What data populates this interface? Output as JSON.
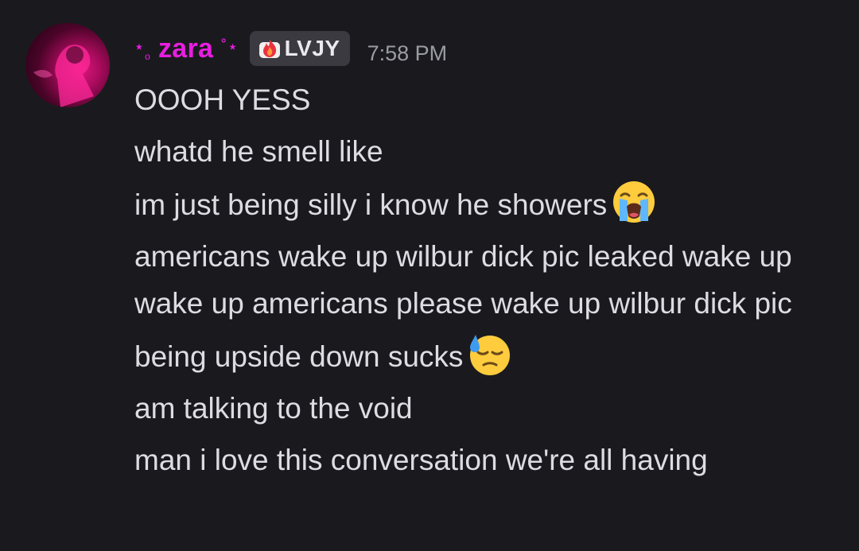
{
  "message": {
    "author": {
      "prefix_deco": "⋆",
      "prefix_circle": "ₒ",
      "name": "zara",
      "suffix_circle": "˚",
      "suffix_deco": "⋆",
      "color": "#e81ee0"
    },
    "tag": {
      "label": "LVJY",
      "icon": "fire-badge-icon"
    },
    "timestamp": "7:58 PM",
    "lines": [
      "OOOH YESS",
      "whatd he smell like",
      "im just being silly i know he showers",
      "americans wake up wilbur dick pic leaked wake up wake up americans please wake up wilbur dick pic",
      "being upside down sucks",
      "am talking to the void",
      "man i love this conversation we're all having"
    ],
    "emojis": {
      "line3": "loudly-crying-face-icon",
      "line5": "downcast-face-with-sweat-icon"
    }
  }
}
